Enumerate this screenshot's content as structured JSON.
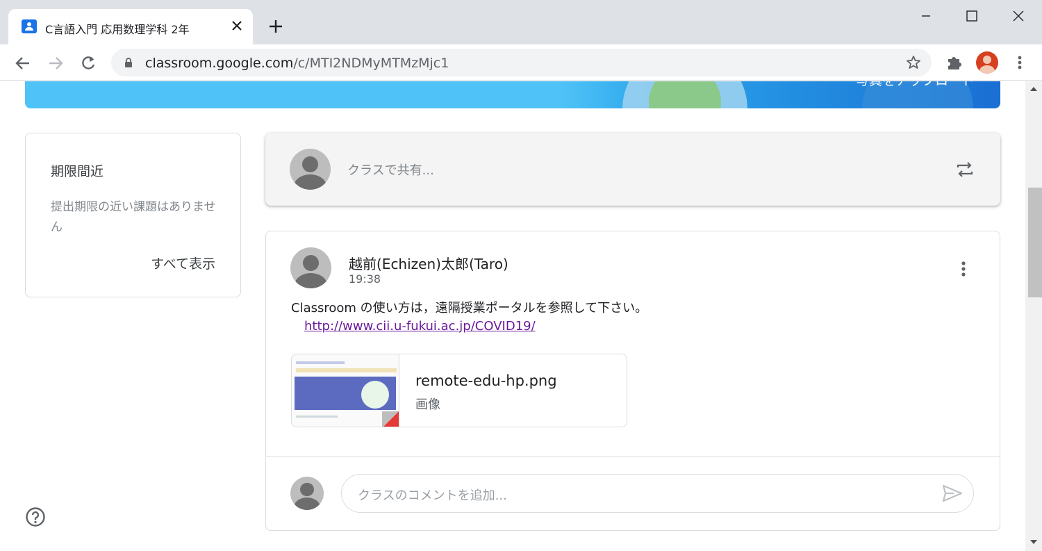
{
  "browser": {
    "tab": {
      "title": "C言語入門 応用数理学科 2年",
      "favicon": "classroom-icon"
    },
    "new_tab_icon": "plus-icon",
    "window_controls": [
      "minimize-icon",
      "maximize-icon",
      "close-icon"
    ],
    "url": {
      "host": "classroom.google.com",
      "path": "/c/MTI2NDMyMTMzMjc1"
    }
  },
  "banner": {
    "upload_text": "写真をアップロード"
  },
  "upcoming": {
    "title": "期限間近",
    "empty_text": "提出期限の近い課題はありません",
    "view_all": "すべて表示"
  },
  "share": {
    "placeholder": "クラスで共有..."
  },
  "post": {
    "author": "越前(Echizen)太郎(Taro)",
    "time": "19:38",
    "body": "Classroom の使い方は，遠隔授業ポータルを参照して下さい。",
    "link": "http://www.cii.u-fukui.ac.jp/COVID19/",
    "attachment": {
      "name": "remote-edu-hp.png",
      "type": "画像"
    },
    "comment_placeholder": "クラスのコメントを追加..."
  },
  "colors": {
    "accent": "#1a73e8",
    "link": "#6a1b9a",
    "profile": "#d6401f",
    "banner": "#4fc3f7"
  }
}
